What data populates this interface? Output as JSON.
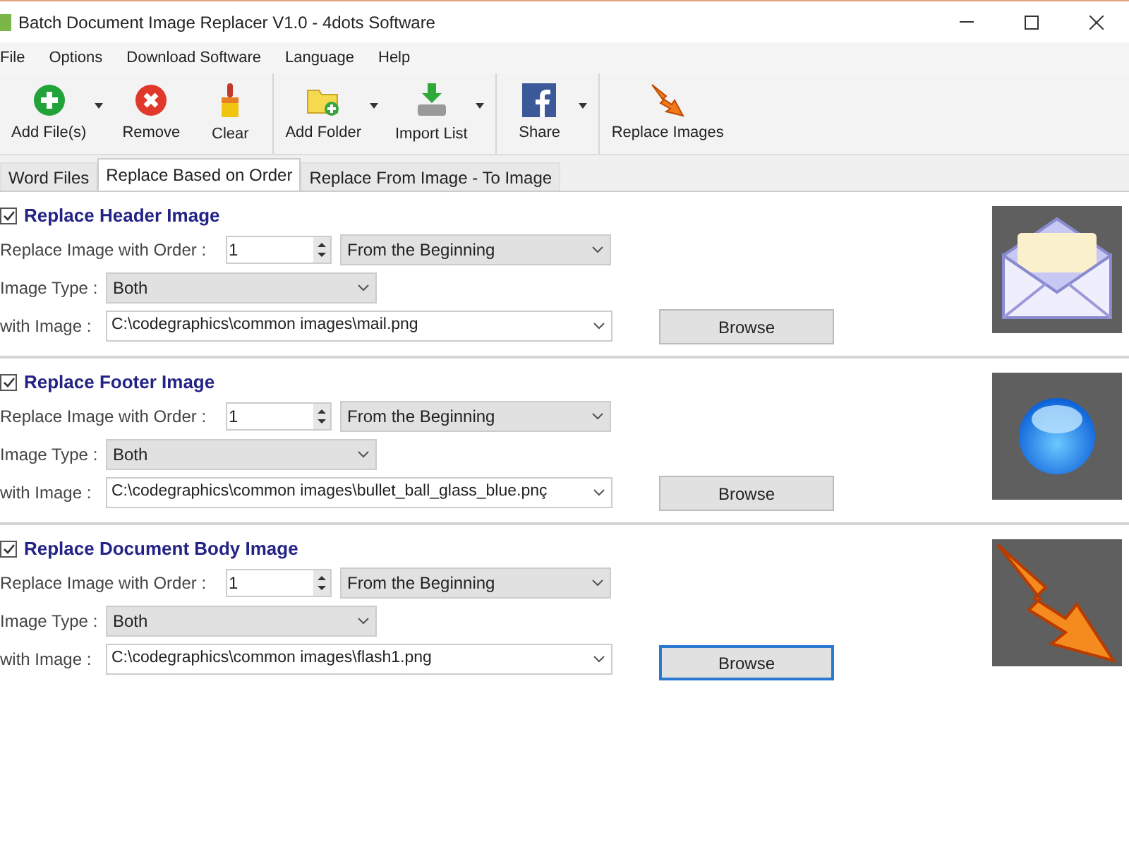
{
  "window": {
    "title": "Batch Document Image Replacer V1.0 - 4dots Software"
  },
  "menu": [
    "File",
    "Options",
    "Download Software",
    "Language",
    "Help"
  ],
  "toolbar": [
    [
      {
        "label": "Add File(s)",
        "kind": "add",
        "dropdown": true
      },
      {
        "label": "Remove",
        "kind": "remove",
        "dropdown": false
      },
      {
        "label": "Clear",
        "kind": "clear",
        "dropdown": false
      }
    ],
    [
      {
        "label": "Add Folder",
        "kind": "folder",
        "dropdown": true
      },
      {
        "label": "Import List",
        "kind": "import",
        "dropdown": true
      }
    ],
    [
      {
        "label": "Share",
        "kind": "share",
        "dropdown": true
      }
    ],
    [
      {
        "label": "Replace Images",
        "kind": "replace",
        "dropdown": false
      }
    ]
  ],
  "tabs": [
    {
      "label": "Word Files",
      "selected": false
    },
    {
      "label": "Replace Based on Order",
      "selected": true
    },
    {
      "label": "Replace From Image - To Image",
      "selected": false
    }
  ],
  "sections": [
    {
      "title": "Replace Header Image",
      "checked": true,
      "order_label": "Replace Image with Order :",
      "order": "1",
      "position": "From the Beginning",
      "type_label": "Image Type :",
      "type": "Both",
      "image_label": "with Image :",
      "image": "C:\\codegraphics\\common images\\mail.png",
      "browse": "Browse",
      "focused": false,
      "kind": "envelope"
    },
    {
      "title": "Replace Footer Image",
      "checked": true,
      "order_label": "Replace Image with Order :",
      "order": "1",
      "position": "From the Beginning",
      "type_label": "Image Type :",
      "type": "Both",
      "image_label": "with Image :",
      "image": "C:\\codegraphics\\common images\\bullet_ball_glass_blue.pnç",
      "browse": "Browse",
      "focused": false,
      "kind": "ball"
    },
    {
      "title": "Replace Document Body Image",
      "checked": true,
      "order_label": "Replace Image with Order :",
      "order": "1",
      "position": "From the Beginning",
      "type_label": "Image Type :",
      "type": "Both",
      "image_label": "with Image :",
      "image": "C:\\codegraphics\\common images\\flash1.png",
      "browse": "Browse",
      "focused": true,
      "kind": "lightning"
    }
  ]
}
